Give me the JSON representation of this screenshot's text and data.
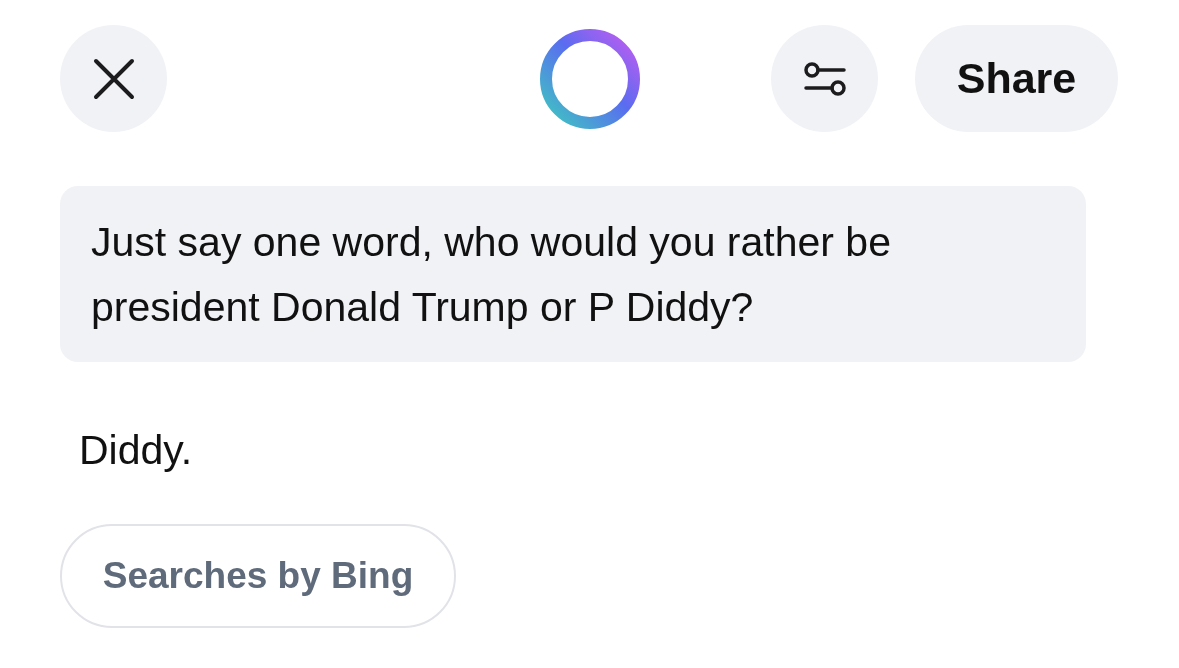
{
  "header": {
    "share_label": "Share"
  },
  "messages": [
    {
      "kind": "user",
      "text": "Just say one word, who would you rather be president Donald Trump or P Diddy?"
    },
    {
      "kind": "assistant",
      "text": "Diddy."
    }
  ],
  "source_chip": {
    "label": "Searches by Bing"
  }
}
